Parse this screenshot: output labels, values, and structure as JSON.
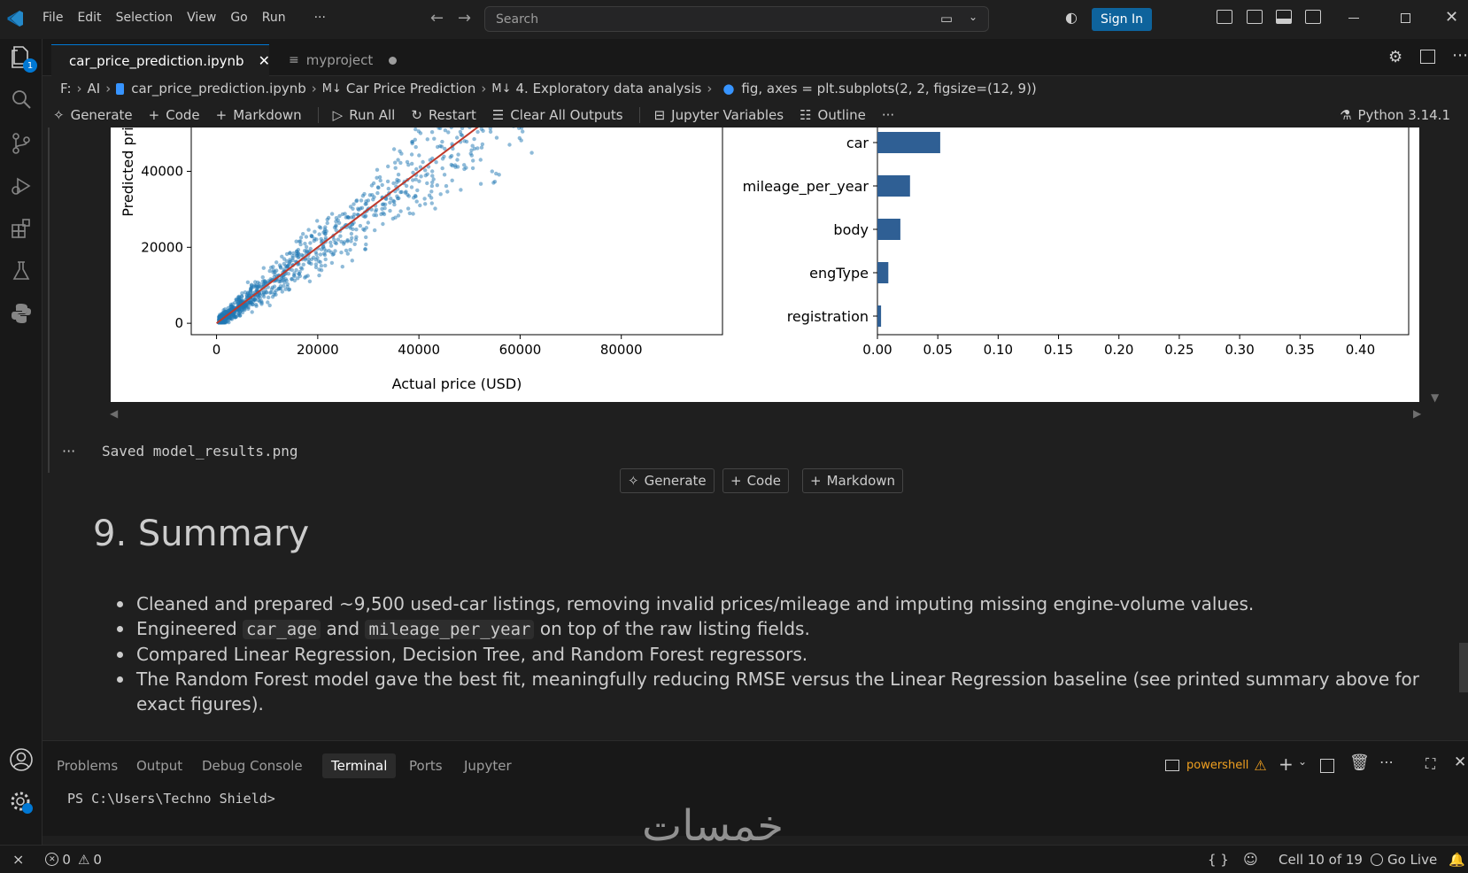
{
  "menu": [
    "File",
    "Edit",
    "Selection",
    "View",
    "Go",
    "Run",
    "···"
  ],
  "search": {
    "placeholder": "Search"
  },
  "signin_label": "Sign In",
  "activity_badge": "1",
  "tabs": [
    {
      "label": "car_price_prediction.ipynb",
      "active": true
    },
    {
      "label": "myproject",
      "modified": true
    }
  ],
  "breadcrumb": [
    "F:",
    "AI",
    "car_price_prediction.ipynb",
    "Car Price Prediction",
    "4. Exploratory data analysis",
    "fig, axes = plt.subplots(2, 2, figsize=(12, 9))"
  ],
  "toolbar": {
    "generate": "Generate",
    "code": "Code",
    "markdown": "Markdown",
    "run_all": "Run All",
    "restart": "Restart",
    "clear_outputs": "Clear All Outputs",
    "variables": "Jupyter Variables",
    "outline": "Outline",
    "more": "···",
    "kernel": "Python 3.14.1"
  },
  "chart_data": [
    {
      "type": "scatter",
      "xlabel": "Actual price (USD)",
      "ylabel": "Predicted pri",
      "xticks": [
        0,
        20000,
        40000,
        60000,
        80000
      ],
      "yticks": [
        0,
        20000,
        40000
      ],
      "xlim": [
        -5000,
        100000
      ],
      "ylim": [
        -3000,
        52000
      ],
      "reference_line": {
        "from": [
          0,
          0
        ],
        "to": [
          52000,
          52000
        ],
        "color": "#c0392b"
      },
      "point_color": "#1f77b4",
      "points_note": "dense cloud along diagonal"
    },
    {
      "type": "bar",
      "orientation": "horizontal",
      "categories": [
        "car",
        "mileage_per_year",
        "body",
        "engType",
        "registration"
      ],
      "values": [
        0.052,
        0.027,
        0.019,
        0.009,
        0.003
      ],
      "xticks": [
        0.0,
        0.05,
        0.1,
        0.15,
        0.2,
        0.25,
        0.3,
        0.35,
        0.4
      ],
      "xtick_labels": [
        "0.00",
        "0.05",
        "0.10",
        "0.15",
        "0.20",
        "0.25",
        "0.30",
        "0.35",
        "0.40"
      ],
      "xlim": [
        0,
        0.44
      ],
      "bar_color": "#2f5f94"
    }
  ],
  "output": {
    "dots": "···",
    "text": "Saved model_results.png"
  },
  "insert": {
    "generate": "Generate",
    "code": "Code",
    "markdown": "Markdown"
  },
  "summary": {
    "heading": "9. Summary",
    "items": [
      "Cleaned and prepared ~9,500 used-car listings, removing invalid prices/mileage and imputing missing engine-volume values.",
      "Compared Linear Regression, Decision Tree, and Random Forest regressors.",
      "The Random Forest model gave the best fit, meaningfully reducing RMSE versus the Linear Regression baseline (see printed summary above for exact figures)."
    ],
    "engineered": {
      "pre": "Engineered",
      "code1": "car_age",
      "mid": "and",
      "code2": "mileage_per_year",
      "post": "on top of the raw listing fields."
    }
  },
  "panel": {
    "tabs": [
      "Problems",
      "Output",
      "Debug Console",
      "Terminal",
      "Ports",
      "Jupyter"
    ],
    "active": "Terminal",
    "shell": "powershell",
    "prompt": "PS C:\\Users\\Techno Shield>"
  },
  "status": {
    "errors": "0",
    "warnings": "0",
    "braces": "{ }",
    "cell": "Cell 10 of 19",
    "golive": "Go Live"
  },
  "watermark": "خمسات"
}
